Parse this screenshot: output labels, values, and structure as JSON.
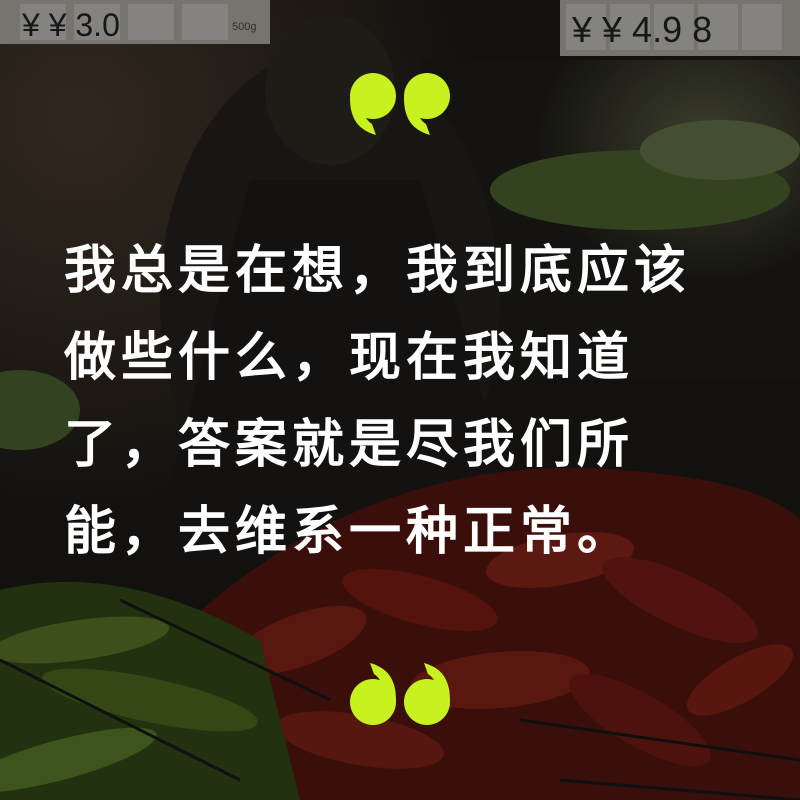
{
  "quote": {
    "lines": [
      "我总是在想，我到底应该",
      "做些什么，现在我知道",
      "了，答案就是尽我们所",
      "能，去维系一种正常。"
    ]
  },
  "price_tags": {
    "left": "¥ ¥ 3.0",
    "right": "¥ ¥ 4.9 8",
    "left_unit": "500g"
  },
  "colors": {
    "quote_mark": "#c8f21f",
    "quote_text": "#ffffff",
    "overlay": "#000000"
  },
  "icons": [
    "quote-open-icon",
    "quote-close-icon"
  ]
}
